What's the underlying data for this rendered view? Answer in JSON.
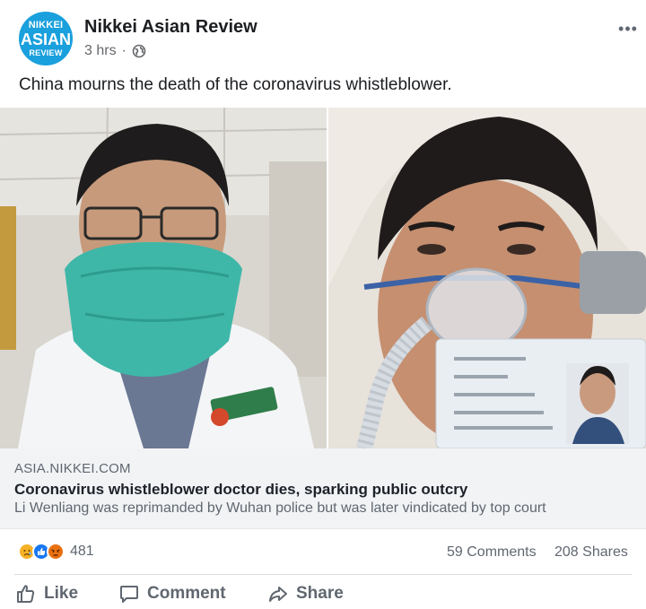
{
  "post": {
    "avatar": {
      "line1": "NIKKEI",
      "line2": "ASIAN",
      "line3": "REVIEW",
      "color": "#1aa0dd"
    },
    "page_name": "Nikkei Asian Review",
    "time": "3 hrs",
    "separator": "·",
    "privacy_icon": "globe-icon",
    "more_icon": "•••",
    "text": "China mourns the death of the coronavirus whistleblower."
  },
  "link": {
    "domain": "ASIA.NIKKEI.COM",
    "title": "Coronavirus whistleblower doctor dies, sparking public outcry",
    "description": "Li Wenliang was reprimanded by Wuhan police but was later vindicated by top court"
  },
  "stats": {
    "reactions": [
      "sad-icon",
      "like-icon",
      "angry-icon"
    ],
    "reaction_count": "481",
    "comments": "59 Comments",
    "shares": "208 Shares"
  },
  "actions": {
    "like": "Like",
    "comment": "Comment",
    "share": "Share"
  },
  "colors": {
    "accent": "#1877f2",
    "text_secondary": "#606770",
    "link_bg": "#f2f3f5"
  }
}
